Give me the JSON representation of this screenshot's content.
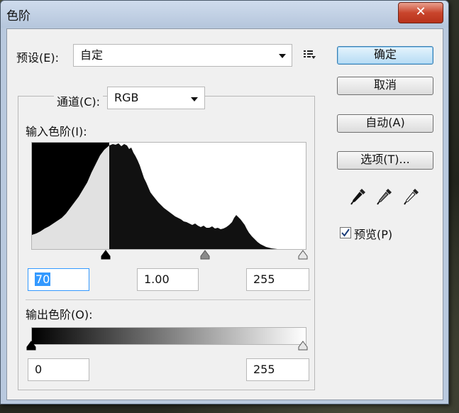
{
  "window": {
    "title": "色阶",
    "close_glyph": "✕"
  },
  "preset": {
    "label": "预设(E):",
    "value": "自定"
  },
  "channel": {
    "label": "通道(C):",
    "value": "RGB"
  },
  "input_levels": {
    "label": "输入色阶(I):",
    "black": "70",
    "gamma": "1.00",
    "white": "255",
    "histogram_clip_level": 70
  },
  "output_levels": {
    "label": "输出色阶(O):",
    "black": "0",
    "white": "255"
  },
  "buttons": {
    "ok": "确定",
    "cancel": "取消",
    "auto": "自动(A)",
    "options": "选项(T)..."
  },
  "preview": {
    "label": "预览(P)",
    "checked": true
  },
  "icons": {
    "preset_menu": "preset-options-icon",
    "eyedroppers": [
      "black-eyedropper-icon",
      "gray-eyedropper-icon",
      "white-eyedropper-icon"
    ]
  },
  "colors": {
    "ok_accent": "#3c7fb1",
    "close_red": "#c9452c",
    "selection": "#3399ff"
  }
}
